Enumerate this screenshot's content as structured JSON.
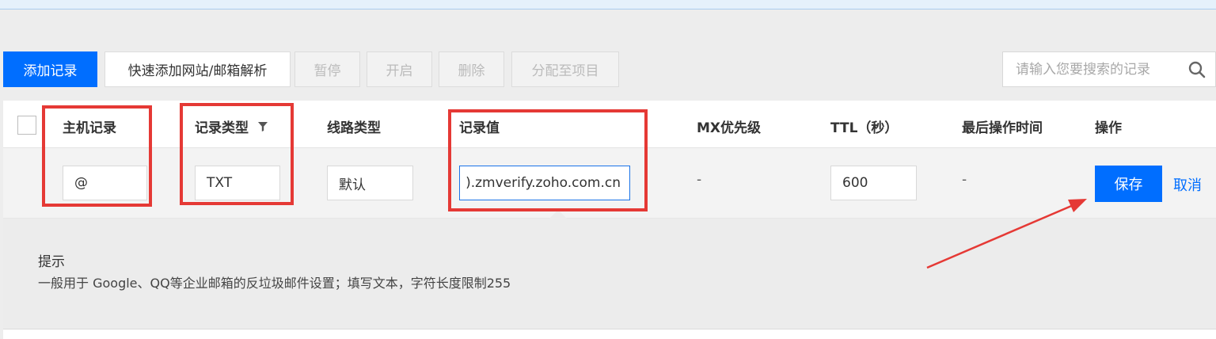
{
  "toolbar": {
    "add_record": "添加记录",
    "quick_add": "快速添加网站/邮箱解析",
    "pause": "暂停",
    "enable": "开启",
    "delete": "删除",
    "assign_project": "分配至项目"
  },
  "search": {
    "placeholder": "请输入您要搜索的记录"
  },
  "table": {
    "headers": {
      "host": "主机记录",
      "type": "记录类型",
      "line": "线路类型",
      "value": "记录值",
      "mx": "MX优先级",
      "ttl": "TTL（秒）",
      "last_modified": "最后操作时间",
      "actions": "操作"
    },
    "edit_row": {
      "host": "@",
      "type": "TXT",
      "line": "默认",
      "value": ").zmverify.zoho.com.cn",
      "mx": "-",
      "ttl": "600",
      "last_modified": "-",
      "save": "保存",
      "cancel": "取消"
    }
  },
  "hint": {
    "title": "提示",
    "text": "一般用于 Google、QQ等企业邮箱的反垃圾邮件设置；填写文本，字符长度限制255"
  },
  "colors": {
    "primary": "#006eff",
    "annotation": "#e53935"
  },
  "icons": [
    "search-icon",
    "filter-icon"
  ]
}
